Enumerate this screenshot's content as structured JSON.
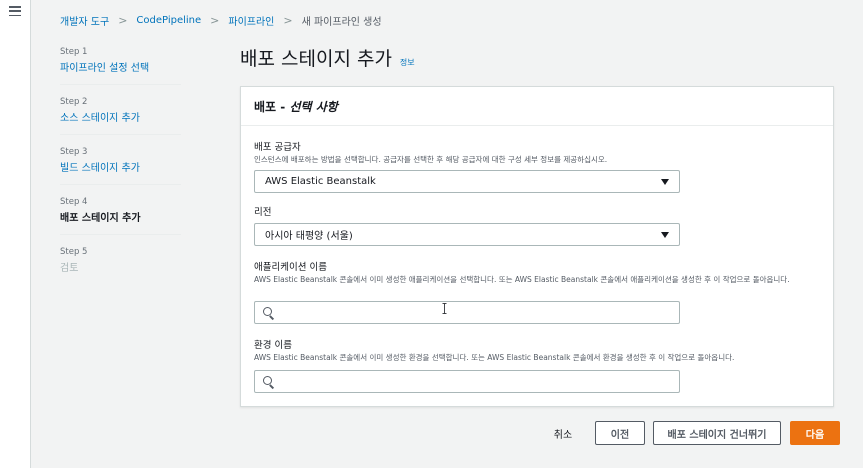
{
  "nav": {
    "menu_icon": "hamburger-menu-icon"
  },
  "breadcrumb": {
    "items": [
      "개발자 도구",
      "CodePipeline",
      "파이프라인"
    ],
    "current": "새 파이프라인 생성",
    "separator": ">"
  },
  "steps": [
    {
      "num": "Step 1",
      "title": "파이프라인 설정 선택",
      "state": "link"
    },
    {
      "num": "Step 2",
      "title": "소스 스테이지 추가",
      "state": "link"
    },
    {
      "num": "Step 3",
      "title": "빌드 스테이지 추가",
      "state": "link"
    },
    {
      "num": "Step 4",
      "title": "배포 스테이지 추가",
      "state": "active"
    },
    {
      "num": "Step 5",
      "title": "검토",
      "state": "disabled"
    }
  ],
  "page": {
    "title": "배포 스테이지 추가",
    "info_link": "정보"
  },
  "panel": {
    "header_strong": "배포",
    "header_sep": " - ",
    "header_em": "선택 사항"
  },
  "provider": {
    "label": "배포 공급자",
    "description": "인스턴스에 배포하는 방법을 선택합니다. 공급자를 선택한 후 해당 공급자에 대한 구성 세부 정보를 제공하십시오.",
    "value": "AWS Elastic Beanstalk"
  },
  "region": {
    "label": "리전",
    "value": "아시아 태평양 (서울)"
  },
  "application": {
    "label": "애플리케이션 이름",
    "description": "AWS Elastic Beanstalk 콘솔에서 이미 생성한 애플리케이션을 선택합니다. 또는 AWS Elastic Beanstalk 콘솔에서 애플리케이션을 생성한 후 이 작업으로 돌아옵니다.",
    "value": ""
  },
  "environment": {
    "label": "환경 이름",
    "description": "AWS Elastic Beanstalk 콘솔에서 이미 생성한 환경을 선택합니다. 또는 AWS Elastic Beanstalk 콘솔에서 환경을 생성한 후 이 작업으로 돌아옵니다.",
    "value": ""
  },
  "footer": {
    "cancel": "취소",
    "previous": "이전",
    "skip": "배포 스테이지 건너뛰기",
    "next": "다음"
  },
  "colors": {
    "accent": "#ec7211",
    "link": "#0073bb",
    "background": "#f2f3f3"
  }
}
